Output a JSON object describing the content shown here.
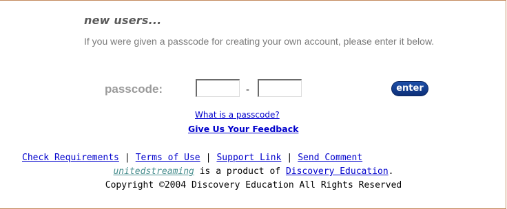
{
  "new_users": {
    "heading": "new users...",
    "intro": "If you were given a passcode for creating your own account, please enter it below."
  },
  "passcode": {
    "label": "passcode:",
    "field1_value": "",
    "separator": "-",
    "field2_value": "",
    "enter_label": "enter"
  },
  "help_links": {
    "what_is_passcode": "What is a passcode?",
    "feedback": "Give Us Your Feedback"
  },
  "footer": {
    "links": [
      "Check Requirements",
      "Terms of Use",
      "Support Link",
      "Send Comment"
    ],
    "separator": "|",
    "product_brand": "unitedstreaming",
    "product_text": " is a product of ",
    "product_company": "Discovery Education",
    "product_end": ".",
    "copyright": "Copyright ©2004 Discovery Education All Rights Reserved"
  },
  "colors": {
    "border": "#c48a5e",
    "link": "#0000cc",
    "button": "#0d2f78",
    "brand": "#4a8f8f"
  }
}
